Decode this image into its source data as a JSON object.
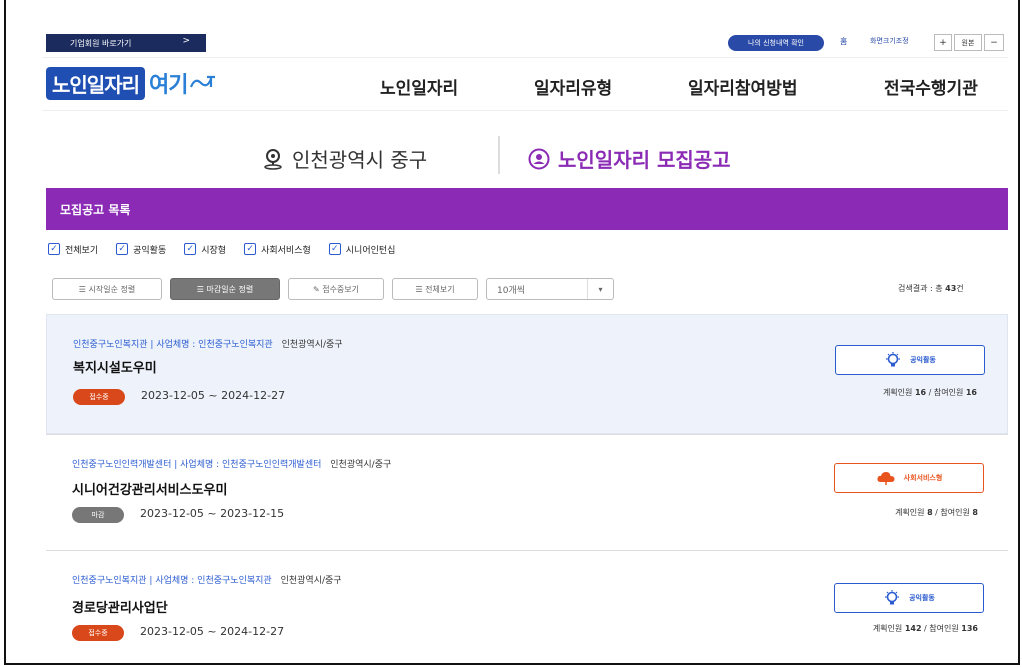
{
  "utility": {
    "corp_button": "기업회원 바로가기",
    "corp_arrow": ">",
    "apply_check": "나의 신청내역 확인",
    "home": "홈",
    "zoom_label": "화면크기조정",
    "zoom_in": "+",
    "zoom_reset": "원본",
    "zoom_out": "−"
  },
  "logo": {
    "part1": "노인일자리",
    "part2": "여기",
    "part3": "ᄋ"
  },
  "nav": [
    "노인일자리",
    "일자리유형",
    "일자리참여방법",
    "전국수행기관"
  ],
  "title": {
    "location": "인천광역시 중구",
    "announcement": "노인일자리 모집공고"
  },
  "list_header": "모집공고 목록",
  "filters": [
    "전체보기",
    "공익활동",
    "시장형",
    "사회서비스형",
    "시니어인턴십"
  ],
  "sort": {
    "by_start": "☰ 시작일순 정렬",
    "by_end": "☰ 마감일순 정렬",
    "accepting": "✎ 접수중보기",
    "all": "☰ 전체보기",
    "page_size": "10개씩",
    "caret": "▾"
  },
  "result": {
    "label": "검색결과 : 총",
    "count": "43",
    "unit": "건"
  },
  "jobs": [
    {
      "org": "인천중구노인복지관",
      "biz_label": "사업체명 : 인천중구노인복지관",
      "region": "인천광역시/중구",
      "title": "복지시설도우미",
      "status": "접수중",
      "period": "2023-12-05 ~ 2024-12-27",
      "type": "공익활동",
      "plan_label": "계획인원",
      "plan": "16",
      "join_label": "참여인원",
      "join": "16"
    },
    {
      "org": "인천중구노인인력개발센터",
      "biz_label": "사업체명 : 인천중구노인인력개발센터",
      "region": "인천광역시/중구",
      "title": "시니어건강관리서비스도우미",
      "status": "마감",
      "period": "2023-12-05 ~ 2023-12-15",
      "type": "사회서비스형",
      "plan_label": "계획인원",
      "plan": "8",
      "join_label": "참여인원",
      "join": "8"
    },
    {
      "org": "인천중구노인복지관",
      "biz_label": "사업체명 : 인천중구노인복지관",
      "region": "인천광역시/중구",
      "title": "경로당관리사업단",
      "status": "접수중",
      "period": "2023-12-05 ~ 2024-12-27",
      "type": "공익활동",
      "plan_label": "계획인원",
      "plan": "142",
      "join_label": "참여인원",
      "join": "136"
    }
  ],
  "colors": {
    "brand_purple": "#8a2ab5",
    "brand_blue": "#1f4fb3",
    "open": "#d9481a",
    "closed": "#777777",
    "social": "#e8531e"
  }
}
